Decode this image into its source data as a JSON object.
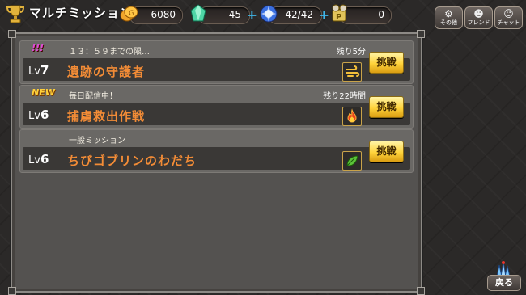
{
  "header": {
    "title": "マルチミッション",
    "gold": "6080",
    "gems": "45",
    "stamina": "42/42",
    "points": "0",
    "point_label": "P",
    "buttons": [
      {
        "label": "その他",
        "icon": "gear-icon"
      },
      {
        "label": "フレンド",
        "icon": "friend-icon"
      },
      {
        "label": "チャット",
        "icon": "chat-icon"
      }
    ]
  },
  "missions": [
    {
      "badge": "!!!",
      "subtitle": "１３：５９までの限…",
      "remaining": "残り5分",
      "lv_prefix": "Lv",
      "level": "7",
      "name": "遺跡の守護者",
      "element": "wind-icon",
      "button": "挑戦"
    },
    {
      "badge": "NEW",
      "subtitle": "毎日配信中！",
      "remaining": "残り22時間",
      "lv_prefix": "Lv",
      "level": "6",
      "name": "捕虜救出作戦",
      "element": "fire-icon",
      "button": "挑戦"
    },
    {
      "badge": "",
      "subtitle": "一般ミッション",
      "remaining": "",
      "lv_prefix": "Lv",
      "level": "6",
      "name": "ちびゴブリンのわだち",
      "element": "leaf-icon",
      "button": "挑戦"
    }
  ],
  "back_button": "戻る",
  "colors": {
    "accent_orange": "#f38c36",
    "button_gold": "#ffd33b",
    "plus_blue": "#3fb6e8"
  }
}
